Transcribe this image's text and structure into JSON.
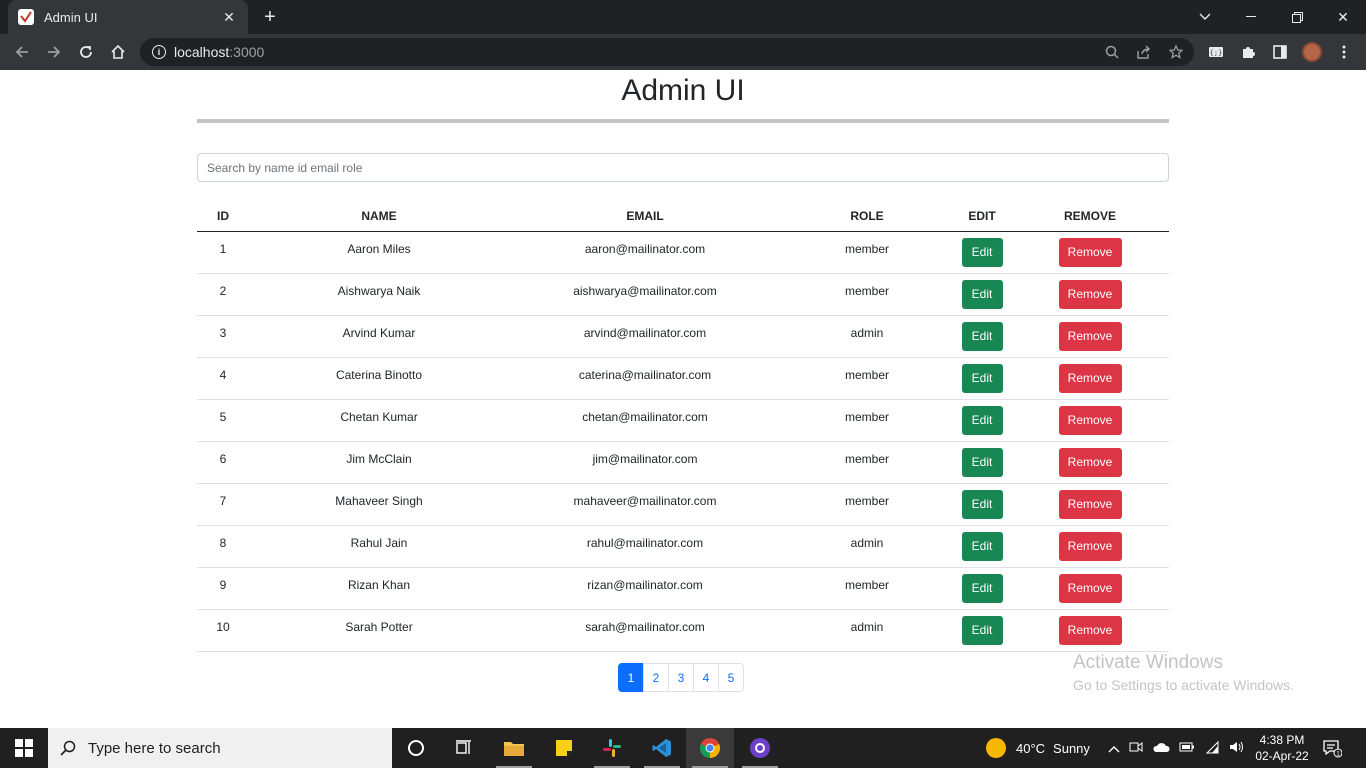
{
  "browser": {
    "tab_title": "Admin UI",
    "url_host": "localhost",
    "url_port": ":3000"
  },
  "page": {
    "title": "Admin UI",
    "search_placeholder": "Search by name id email role"
  },
  "table": {
    "headers": [
      "ID",
      "NAME",
      "EMAIL",
      "ROLE",
      "EDIT",
      "REMOVE"
    ],
    "edit_label": "Edit",
    "remove_label": "Remove",
    "rows": [
      {
        "id": "1",
        "name": "Aaron Miles",
        "email": "aaron@mailinator.com",
        "role": "member"
      },
      {
        "id": "2",
        "name": "Aishwarya Naik",
        "email": "aishwarya@mailinator.com",
        "role": "member"
      },
      {
        "id": "3",
        "name": "Arvind Kumar",
        "email": "arvind@mailinator.com",
        "role": "admin"
      },
      {
        "id": "4",
        "name": "Caterina Binotto",
        "email": "caterina@mailinator.com",
        "role": "member"
      },
      {
        "id": "5",
        "name": "Chetan Kumar",
        "email": "chetan@mailinator.com",
        "role": "member"
      },
      {
        "id": "6",
        "name": "Jim McClain",
        "email": "jim@mailinator.com",
        "role": "member"
      },
      {
        "id": "7",
        "name": "Mahaveer Singh",
        "email": "mahaveer@mailinator.com",
        "role": "member"
      },
      {
        "id": "8",
        "name": "Rahul Jain",
        "email": "rahul@mailinator.com",
        "role": "admin"
      },
      {
        "id": "9",
        "name": "Rizan Khan",
        "email": "rizan@mailinator.com",
        "role": "member"
      },
      {
        "id": "10",
        "name": "Sarah Potter",
        "email": "sarah@mailinator.com",
        "role": "admin"
      }
    ]
  },
  "pagination": {
    "pages": [
      "1",
      "2",
      "3",
      "4",
      "5"
    ],
    "active": "1"
  },
  "watermark": {
    "line1": "Activate Windows",
    "line2": "Go to Settings to activate Windows."
  },
  "taskbar": {
    "search_placeholder": "Type here to search",
    "weather_temp": "40°C",
    "weather_desc": "Sunny",
    "time": "4:38 PM",
    "date": "02-Apr-22",
    "notification_count": "1"
  },
  "colors": {
    "edit": "#198754",
    "remove": "#dc3545",
    "page_active": "#0d6efd"
  }
}
